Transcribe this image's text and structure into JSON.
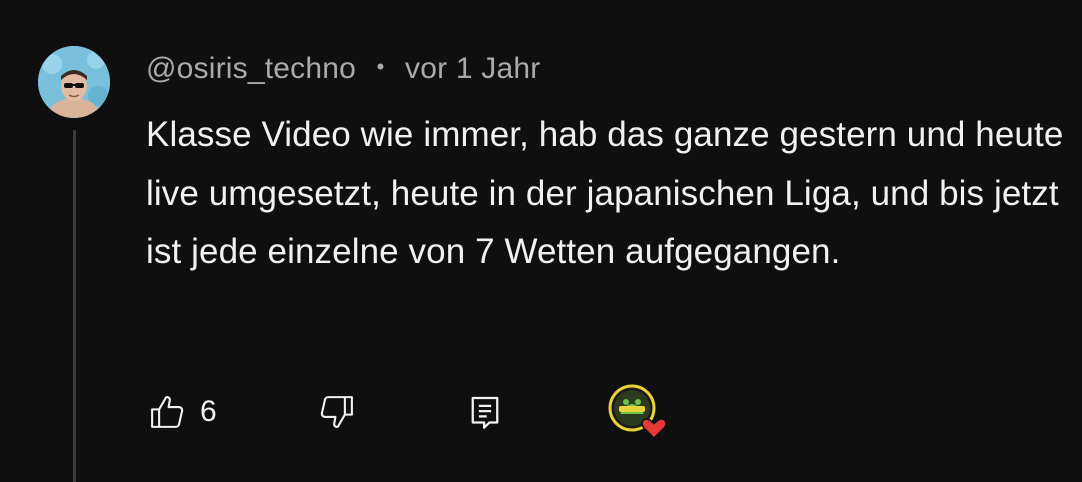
{
  "comment": {
    "author": "@osiris_techno",
    "separator": "•",
    "timestamp": "vor 1 Jahr",
    "text": "Klasse Video wie immer, hab das ganze gestern und heute live umgesetzt, heute in der japanischen Liga, und bis jetzt ist jede einzelne von 7 Wetten aufgegangen.",
    "like_count": "6"
  },
  "icons": {
    "like": "thumbs-up-icon",
    "dislike": "thumbs-down-icon",
    "reply": "reply-icon",
    "creator_heart": "creator-heart-icon"
  },
  "colors": {
    "background": "#0f0f0f",
    "text": "#f1f1f1",
    "meta": "#aaaaaa",
    "heart": "#e53935"
  }
}
